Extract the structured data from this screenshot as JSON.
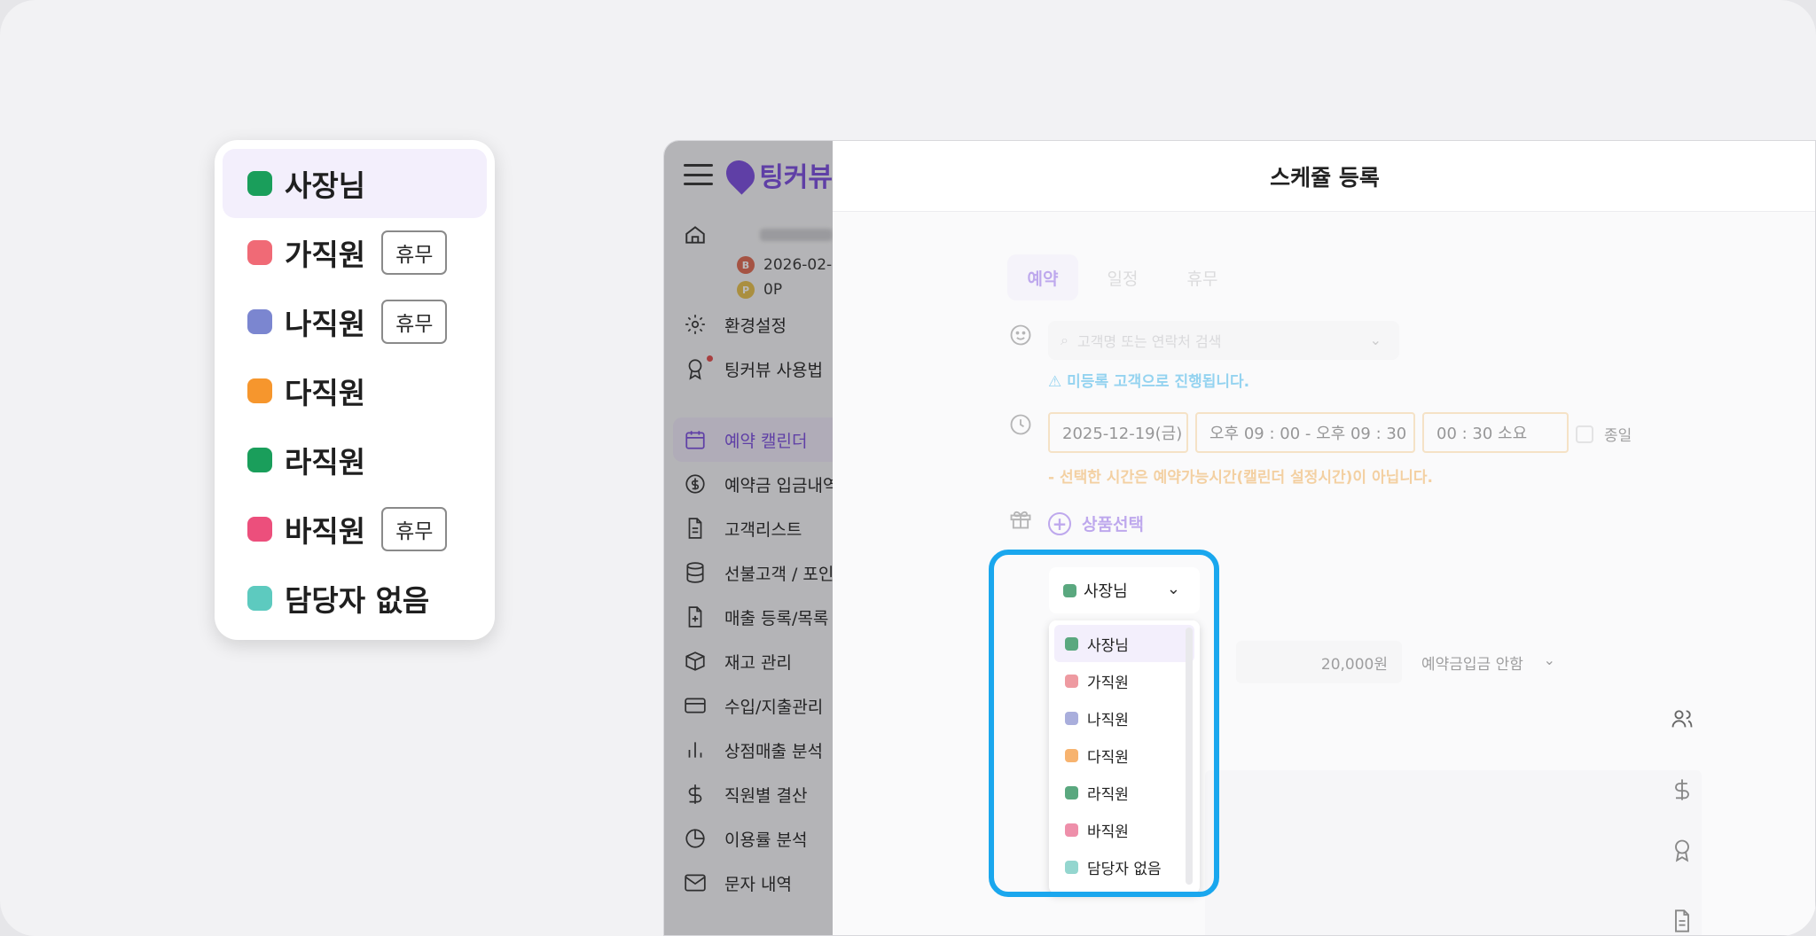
{
  "zoom_popover": {
    "items": [
      {
        "label": "사장님",
        "color": "#1a9e5b",
        "badge": ""
      },
      {
        "label": "가직원",
        "color": "#f06a76",
        "badge": "휴무"
      },
      {
        "label": "나직원",
        "color": "#7b86d0",
        "badge": "휴무"
      },
      {
        "label": "다직원",
        "color": "#f6962d",
        "badge": ""
      },
      {
        "label": "라직원",
        "color": "#1a9e5b",
        "badge": ""
      },
      {
        "label": "바직원",
        "color": "#ec4f7c",
        "badge": "휴무"
      },
      {
        "label": "담당자 없음",
        "color": "#5dcabf",
        "badge": ""
      }
    ]
  },
  "app": {
    "logo_text": "팅커뷰",
    "profile": {
      "date": "2026-02-",
      "points": "0P"
    },
    "nav": [
      {
        "label": "환경설정",
        "icon": "gear-icon"
      },
      {
        "label": "팅커뷰 사용법",
        "icon": "badge-icon"
      },
      {
        "label": "예약 캘린더",
        "icon": "calendar-icon",
        "active": true
      },
      {
        "label": "예약금 입금내역",
        "icon": "dollar-circle-icon"
      },
      {
        "label": "고객리스트",
        "icon": "document-icon"
      },
      {
        "label": "선불고객 / 포인트",
        "icon": "database-icon"
      },
      {
        "label": "매출 등록/목록",
        "icon": "file-plus-icon"
      },
      {
        "label": "재고 관리",
        "icon": "box-icon"
      },
      {
        "label": "수입/지출관리",
        "icon": "card-icon"
      },
      {
        "label": "상점매출 분석",
        "icon": "bar-chart-icon"
      },
      {
        "label": "직원별 결산",
        "icon": "dollar-icon"
      },
      {
        "label": "이용률 분석",
        "icon": "pie-icon"
      },
      {
        "label": "문자 내역",
        "icon": "mail-icon"
      }
    ]
  },
  "drawer": {
    "title": "스케쥴 등록",
    "tabs": [
      "예약",
      "일정",
      "휴무"
    ],
    "search_placeholder": "고객명 또는 연락처 검색",
    "unregistered_notice": "⚠ 미등록 고객으로 진행됩니다.",
    "date": "2025-12-19(금)",
    "time_range": "오후 09 : 00 - 오후 09 : 30",
    "duration": "00 : 30 소요",
    "allday_label": "종일",
    "time_warning": "- 선택한 시간은 예약가능시간(캘린더 설정시간)이 아닙니다.",
    "product_button": "상품선택",
    "price": "20,000원",
    "deposit_status": "예약금입금 안함",
    "staff_selected": "사장님",
    "staff_selected_color": "#5aa87f",
    "staff_options": [
      {
        "label": "사장님",
        "color": "#5aa87f"
      },
      {
        "label": "가직원",
        "color": "#ee9aa1"
      },
      {
        "label": "나직원",
        "color": "#a9aedc"
      },
      {
        "label": "다직원",
        "color": "#f7b36f"
      },
      {
        "label": "라직원",
        "color": "#5aa87f"
      },
      {
        "label": "바직원",
        "color": "#ee8faa"
      },
      {
        "label": "담당자 없음",
        "color": "#94d6cf"
      }
    ]
  },
  "colors": {
    "accent": "#7a4be0",
    "highlight_ring": "#1aa7ee",
    "warning_orange": "#f0a23a",
    "info_blue": "#1ea8e6"
  }
}
